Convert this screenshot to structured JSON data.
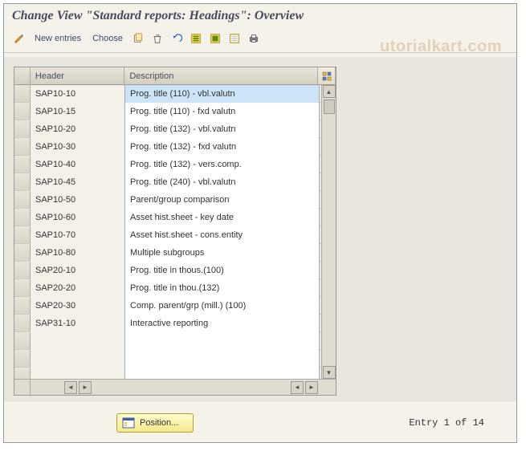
{
  "title": "Change View \"Standard reports: Headings\": Overview",
  "watermark": "utorialkart.com",
  "toolbar": {
    "new_entries": "New entries",
    "choose": "Choose"
  },
  "grid": {
    "headers": {
      "header": "Header",
      "description": "Description"
    },
    "rows": [
      {
        "header": "SAP10-10",
        "description": "Prog. title (110) - vbl.valutn",
        "selected": true
      },
      {
        "header": "SAP10-15",
        "description": "Prog. title (110) - fxd valutn"
      },
      {
        "header": "SAP10-20",
        "description": "Prog. title (132) - vbl.valutn"
      },
      {
        "header": "SAP10-30",
        "description": "Prog. title (132) - fxd valutn"
      },
      {
        "header": "SAP10-40",
        "description": "Prog. title (132) - vers.comp."
      },
      {
        "header": "SAP10-45",
        "description": "Prog. title (240) - vbl.valutn"
      },
      {
        "header": "SAP10-50",
        "description": "Parent/group comparison"
      },
      {
        "header": "SAP10-60",
        "description": "Asset hist.sheet - key date"
      },
      {
        "header": "SAP10-70",
        "description": "Asset hist.sheet - cons.entity"
      },
      {
        "header": "SAP10-80",
        "description": "Multiple subgroups"
      },
      {
        "header": "SAP20-10",
        "description": "Prog. title in thous.(100)"
      },
      {
        "header": "SAP20-20",
        "description": "Prog. title in thou.(132)"
      },
      {
        "header": "SAP20-30",
        "description": "Comp. parent/grp (mill.) (100)"
      },
      {
        "header": "SAP31-10",
        "description": "Interactive reporting"
      }
    ],
    "blank_rows": 3
  },
  "footer": {
    "position_label": "Position...",
    "entry_status": "Entry 1 of 14"
  }
}
